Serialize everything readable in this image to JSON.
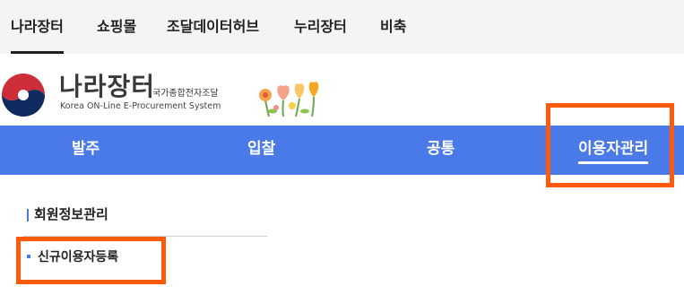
{
  "top_tabs": [
    {
      "label": "나라장터"
    },
    {
      "label": "쇼핑몰"
    },
    {
      "label": "조달데이터허브"
    },
    {
      "label": "누리장터"
    },
    {
      "label": "비축"
    }
  ],
  "logo": {
    "title": "나라장터",
    "subtitle_ko": "국가종합전자조달",
    "subtitle_en": "Korea ON-Line E-Procurement System"
  },
  "main_nav": [
    {
      "label": "발주"
    },
    {
      "label": "입찰"
    },
    {
      "label": "공통"
    },
    {
      "label": "이용자관리"
    }
  ],
  "side_menu": {
    "section_title": "회원정보관리",
    "items": [
      {
        "label": "신규이용자등록"
      }
    ]
  },
  "colors": {
    "nav_blue": "#4a7ae8",
    "highlight_orange": "#ff5a0a",
    "topbar_bg": "#f3f4f6"
  }
}
